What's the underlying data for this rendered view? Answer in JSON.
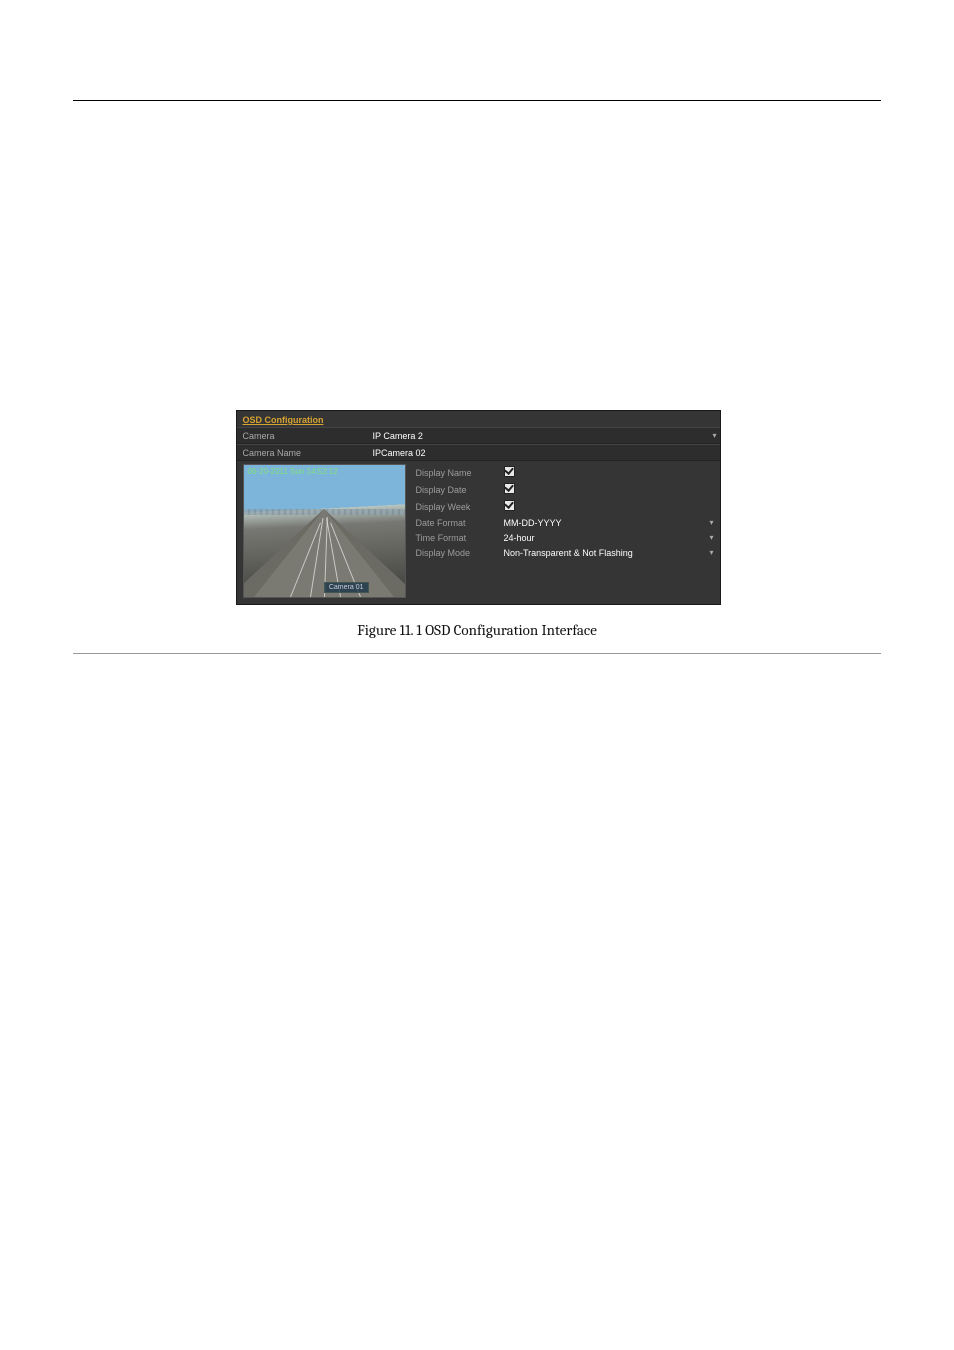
{
  "caption": "Figure 11. 1  OSD Configuration Interface",
  "ui": {
    "title": "OSD Configuration",
    "camera": {
      "label": "Camera",
      "value": "IP Camera 2"
    },
    "camera_name": {
      "label": "Camera Name",
      "value": "IPCamera 02"
    },
    "preview": {
      "timestamp": "06-20-2011 Sun 14:52:12",
      "tag": "Camera 01"
    },
    "settings": {
      "display_name": {
        "label": "Display Name",
        "checked": true
      },
      "display_date": {
        "label": "Display Date",
        "checked": true
      },
      "display_week": {
        "label": "Display Week",
        "checked": true
      },
      "date_format": {
        "label": "Date Format",
        "value": "MM-DD-YYYY"
      },
      "time_format": {
        "label": "Time Format",
        "value": "24-hour"
      },
      "display_mode": {
        "label": "Display Mode",
        "value": "Non-Transparent & Not Flashing"
      }
    }
  },
  "glyphs": {
    "dd": "▾"
  }
}
